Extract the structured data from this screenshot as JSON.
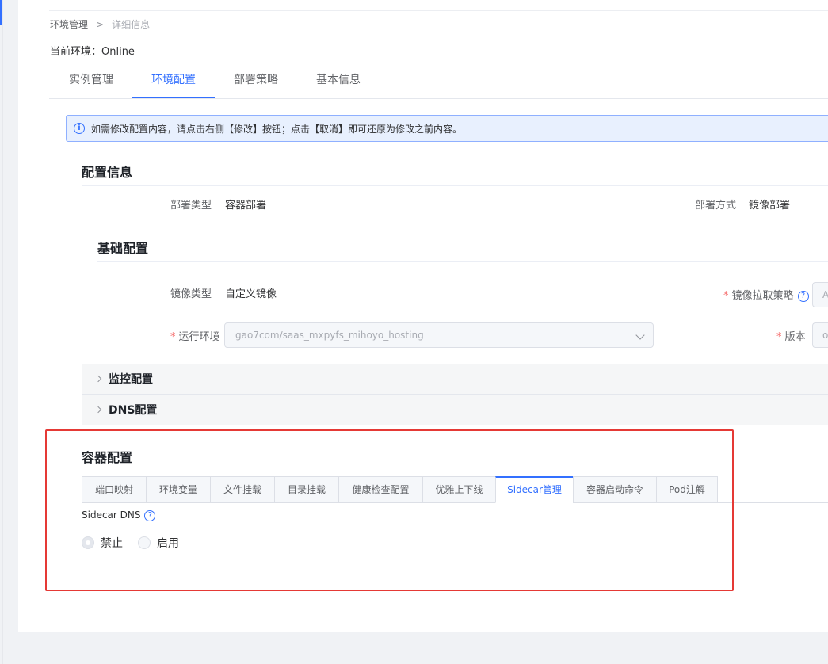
{
  "top_fragment": "",
  "breadcrumb": {
    "root": "环境管理",
    "sep": ">",
    "current": "详细信息"
  },
  "env": "当前环境：Online",
  "tabs": [
    {
      "label": "实例管理"
    },
    {
      "label": "环境配置"
    },
    {
      "label": "部署策略"
    },
    {
      "label": "基本信息"
    }
  ],
  "alert": {
    "icon": "i",
    "text": "如需修改配置内容，请点击右侧【修改】按钮；点击【取消】即可还原为修改之前内容。"
  },
  "config_info": {
    "title": "配置信息",
    "deploy_type_label": "部署类型",
    "deploy_type_value": "容器部署",
    "deploy_mode_label": "部署方式",
    "deploy_mode_value": "镜像部署"
  },
  "basic": {
    "title": "基础配置",
    "image_type_label": "镜像类型",
    "image_type_value": "自定义镜像",
    "pull_policy_label": "镜像拉取策略",
    "pull_policy_partial": "A",
    "runtime_label": "运行环境",
    "runtime_value": "gao7com/saas_mxpyfs_mihoyo_hosting",
    "version_label": "版本",
    "version_partial": "o",
    "required": "*",
    "help": "?"
  },
  "collapses": {
    "monitor": "监控配置",
    "dns": "DNS配置"
  },
  "container": {
    "title": "容器配置",
    "subtabs": [
      "端口映射",
      "环境变量",
      "文件挂载",
      "目录挂载",
      "健康检查配置",
      "优雅上下线",
      "Sidecar管理",
      "容器启动命令",
      "Pod注解"
    ],
    "sidecar_dns_label": "Sidecar DNS",
    "help": "?",
    "radio_disable": "禁止",
    "radio_enable": "启用"
  },
  "colors": {
    "accent": "#3370ff",
    "highlight_box": "#e53935",
    "required": "#f56c6c"
  }
}
